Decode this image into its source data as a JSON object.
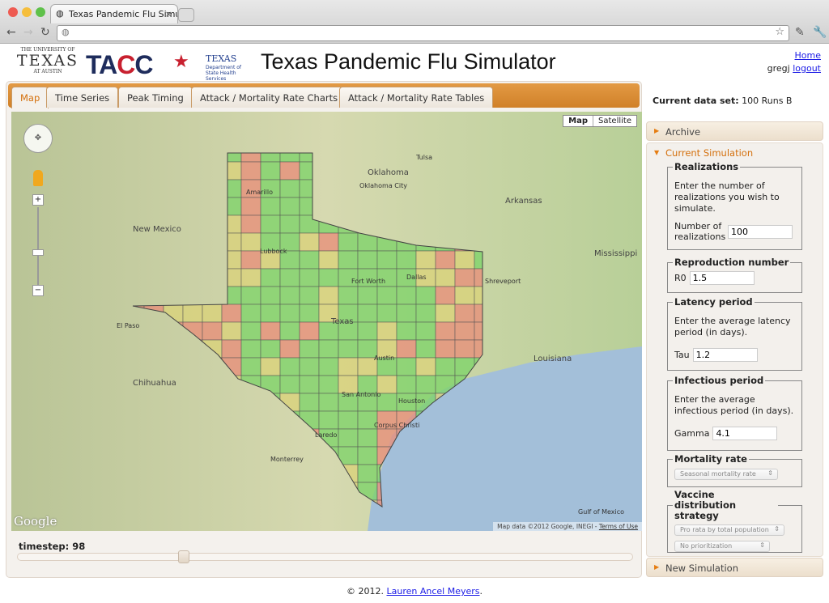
{
  "browser": {
    "tab_title": "Texas Pandemic Flu Simulator",
    "url": ""
  },
  "header": {
    "title": "Texas Pandemic Flu Simulator",
    "logos": {
      "ut": "THE UNIVERSITY OF TEXAS AT AUSTIN",
      "tacc": "TACC",
      "dshs": "TEXAS Department of State Health Services"
    },
    "home_link": "Home",
    "user": "gregj",
    "logout_link": "logout"
  },
  "tabs": [
    {
      "label": "Map",
      "active": true
    },
    {
      "label": "Time Series"
    },
    {
      "label": "Peak Timing"
    },
    {
      "label": "Attack / Mortality Rate Charts"
    },
    {
      "label": "Attack / Mortality Rate Tables"
    }
  ],
  "map": {
    "type_buttons": [
      "Map",
      "Satellite"
    ],
    "selected_type": "Map",
    "attribution": "Map data ©2012 Google, INEGI - ",
    "terms_link": "Terms of Use",
    "google_logo": "Google",
    "labels": [
      {
        "t": "Oklahoma City",
        "big": false
      },
      {
        "t": "Dallas"
      },
      {
        "t": "Fort Worth"
      },
      {
        "t": "Austin"
      },
      {
        "t": "San Antonio"
      },
      {
        "t": "Houston"
      },
      {
        "t": "Lubbock"
      },
      {
        "t": "Amarillo"
      },
      {
        "t": "Corpus Christi"
      },
      {
        "t": "El Paso"
      },
      {
        "t": "Oklahoma"
      },
      {
        "t": "Arkansas"
      },
      {
        "t": "Louisiana"
      },
      {
        "t": "Mississippi"
      },
      {
        "t": "New Mexico"
      },
      {
        "t": "Chihuahua"
      },
      {
        "t": "Texas"
      },
      {
        "t": "Tulsa"
      },
      {
        "t": "Shreveport"
      },
      {
        "t": "Laredo"
      },
      {
        "t": "Monterrey"
      },
      {
        "t": "Gulf of Mexico"
      }
    ],
    "colors": {
      "low": "#7fd36a",
      "mid": "#d9d27a",
      "high": "#e7907a",
      "water": "#a3bfd9"
    }
  },
  "timestep": {
    "label": "timestep:",
    "value": "98",
    "fraction": 0.27
  },
  "sidebar": {
    "dataset_label": "Current data set:",
    "dataset_value": "100 Runs B",
    "archive": "Archive",
    "current": "Current Simulation",
    "new_sim": "New Simulation",
    "realizations": {
      "legend": "Realizations",
      "desc": "Enter the number of realizations you wish to simulate.",
      "label": "Number of realizations",
      "value": "100"
    },
    "reproduction": {
      "legend": "Reproduction number",
      "label": "R0",
      "value": "1.5"
    },
    "latency": {
      "legend": "Latency period",
      "desc": "Enter the average latency period (in days).",
      "label": "Tau",
      "value": "1.2"
    },
    "infectious": {
      "legend": "Infectious period",
      "desc": "Enter the average infectious period (in days).",
      "label": "Gamma",
      "value": "4.1"
    },
    "mortality": {
      "legend": "Mortality rate",
      "selected": "Seasonal mortality rate"
    },
    "vaccine": {
      "legend": "Vaccine distribution strategy",
      "selected1": "Pro rata by total population",
      "selected2": "No prioritization"
    }
  },
  "footer": {
    "copyright": "© 2012.",
    "author_link": "Lauren Ancel Meyers",
    "end": "."
  }
}
